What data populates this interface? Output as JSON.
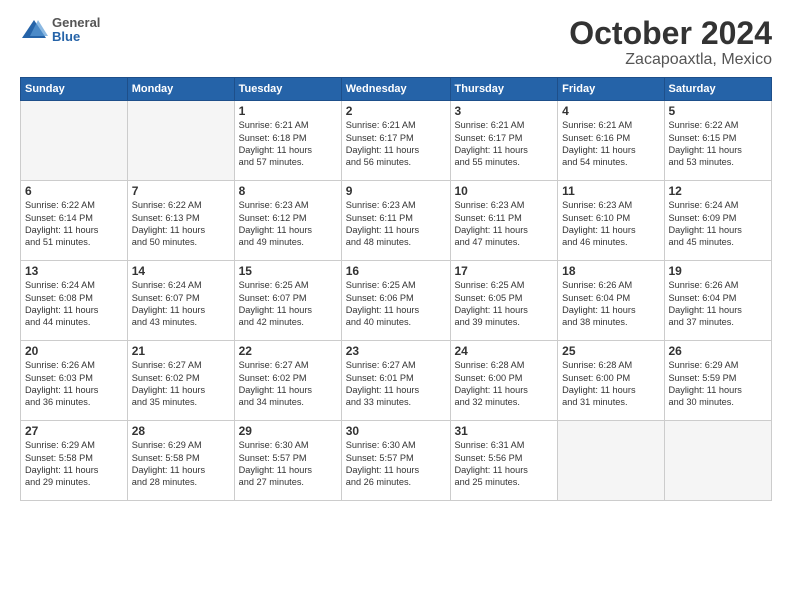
{
  "header": {
    "logo_line1": "General",
    "logo_line2": "Blue",
    "title": "October 2024",
    "subtitle": "Zacapoaxtla, Mexico"
  },
  "days_of_week": [
    "Sunday",
    "Monday",
    "Tuesday",
    "Wednesday",
    "Thursday",
    "Friday",
    "Saturday"
  ],
  "weeks": [
    [
      {
        "day": "",
        "info": ""
      },
      {
        "day": "",
        "info": ""
      },
      {
        "day": "1",
        "info": "Sunrise: 6:21 AM\nSunset: 6:18 PM\nDaylight: 11 hours\nand 57 minutes."
      },
      {
        "day": "2",
        "info": "Sunrise: 6:21 AM\nSunset: 6:17 PM\nDaylight: 11 hours\nand 56 minutes."
      },
      {
        "day": "3",
        "info": "Sunrise: 6:21 AM\nSunset: 6:17 PM\nDaylight: 11 hours\nand 55 minutes."
      },
      {
        "day": "4",
        "info": "Sunrise: 6:21 AM\nSunset: 6:16 PM\nDaylight: 11 hours\nand 54 minutes."
      },
      {
        "day": "5",
        "info": "Sunrise: 6:22 AM\nSunset: 6:15 PM\nDaylight: 11 hours\nand 53 minutes."
      }
    ],
    [
      {
        "day": "6",
        "info": "Sunrise: 6:22 AM\nSunset: 6:14 PM\nDaylight: 11 hours\nand 51 minutes."
      },
      {
        "day": "7",
        "info": "Sunrise: 6:22 AM\nSunset: 6:13 PM\nDaylight: 11 hours\nand 50 minutes."
      },
      {
        "day": "8",
        "info": "Sunrise: 6:23 AM\nSunset: 6:12 PM\nDaylight: 11 hours\nand 49 minutes."
      },
      {
        "day": "9",
        "info": "Sunrise: 6:23 AM\nSunset: 6:11 PM\nDaylight: 11 hours\nand 48 minutes."
      },
      {
        "day": "10",
        "info": "Sunrise: 6:23 AM\nSunset: 6:11 PM\nDaylight: 11 hours\nand 47 minutes."
      },
      {
        "day": "11",
        "info": "Sunrise: 6:23 AM\nSunset: 6:10 PM\nDaylight: 11 hours\nand 46 minutes."
      },
      {
        "day": "12",
        "info": "Sunrise: 6:24 AM\nSunset: 6:09 PM\nDaylight: 11 hours\nand 45 minutes."
      }
    ],
    [
      {
        "day": "13",
        "info": "Sunrise: 6:24 AM\nSunset: 6:08 PM\nDaylight: 11 hours\nand 44 minutes."
      },
      {
        "day": "14",
        "info": "Sunrise: 6:24 AM\nSunset: 6:07 PM\nDaylight: 11 hours\nand 43 minutes."
      },
      {
        "day": "15",
        "info": "Sunrise: 6:25 AM\nSunset: 6:07 PM\nDaylight: 11 hours\nand 42 minutes."
      },
      {
        "day": "16",
        "info": "Sunrise: 6:25 AM\nSunset: 6:06 PM\nDaylight: 11 hours\nand 40 minutes."
      },
      {
        "day": "17",
        "info": "Sunrise: 6:25 AM\nSunset: 6:05 PM\nDaylight: 11 hours\nand 39 minutes."
      },
      {
        "day": "18",
        "info": "Sunrise: 6:26 AM\nSunset: 6:04 PM\nDaylight: 11 hours\nand 38 minutes."
      },
      {
        "day": "19",
        "info": "Sunrise: 6:26 AM\nSunset: 6:04 PM\nDaylight: 11 hours\nand 37 minutes."
      }
    ],
    [
      {
        "day": "20",
        "info": "Sunrise: 6:26 AM\nSunset: 6:03 PM\nDaylight: 11 hours\nand 36 minutes."
      },
      {
        "day": "21",
        "info": "Sunrise: 6:27 AM\nSunset: 6:02 PM\nDaylight: 11 hours\nand 35 minutes."
      },
      {
        "day": "22",
        "info": "Sunrise: 6:27 AM\nSunset: 6:02 PM\nDaylight: 11 hours\nand 34 minutes."
      },
      {
        "day": "23",
        "info": "Sunrise: 6:27 AM\nSunset: 6:01 PM\nDaylight: 11 hours\nand 33 minutes."
      },
      {
        "day": "24",
        "info": "Sunrise: 6:28 AM\nSunset: 6:00 PM\nDaylight: 11 hours\nand 32 minutes."
      },
      {
        "day": "25",
        "info": "Sunrise: 6:28 AM\nSunset: 6:00 PM\nDaylight: 11 hours\nand 31 minutes."
      },
      {
        "day": "26",
        "info": "Sunrise: 6:29 AM\nSunset: 5:59 PM\nDaylight: 11 hours\nand 30 minutes."
      }
    ],
    [
      {
        "day": "27",
        "info": "Sunrise: 6:29 AM\nSunset: 5:58 PM\nDaylight: 11 hours\nand 29 minutes."
      },
      {
        "day": "28",
        "info": "Sunrise: 6:29 AM\nSunset: 5:58 PM\nDaylight: 11 hours\nand 28 minutes."
      },
      {
        "day": "29",
        "info": "Sunrise: 6:30 AM\nSunset: 5:57 PM\nDaylight: 11 hours\nand 27 minutes."
      },
      {
        "day": "30",
        "info": "Sunrise: 6:30 AM\nSunset: 5:57 PM\nDaylight: 11 hours\nand 26 minutes."
      },
      {
        "day": "31",
        "info": "Sunrise: 6:31 AM\nSunset: 5:56 PM\nDaylight: 11 hours\nand 25 minutes."
      },
      {
        "day": "",
        "info": ""
      },
      {
        "day": "",
        "info": ""
      }
    ]
  ]
}
